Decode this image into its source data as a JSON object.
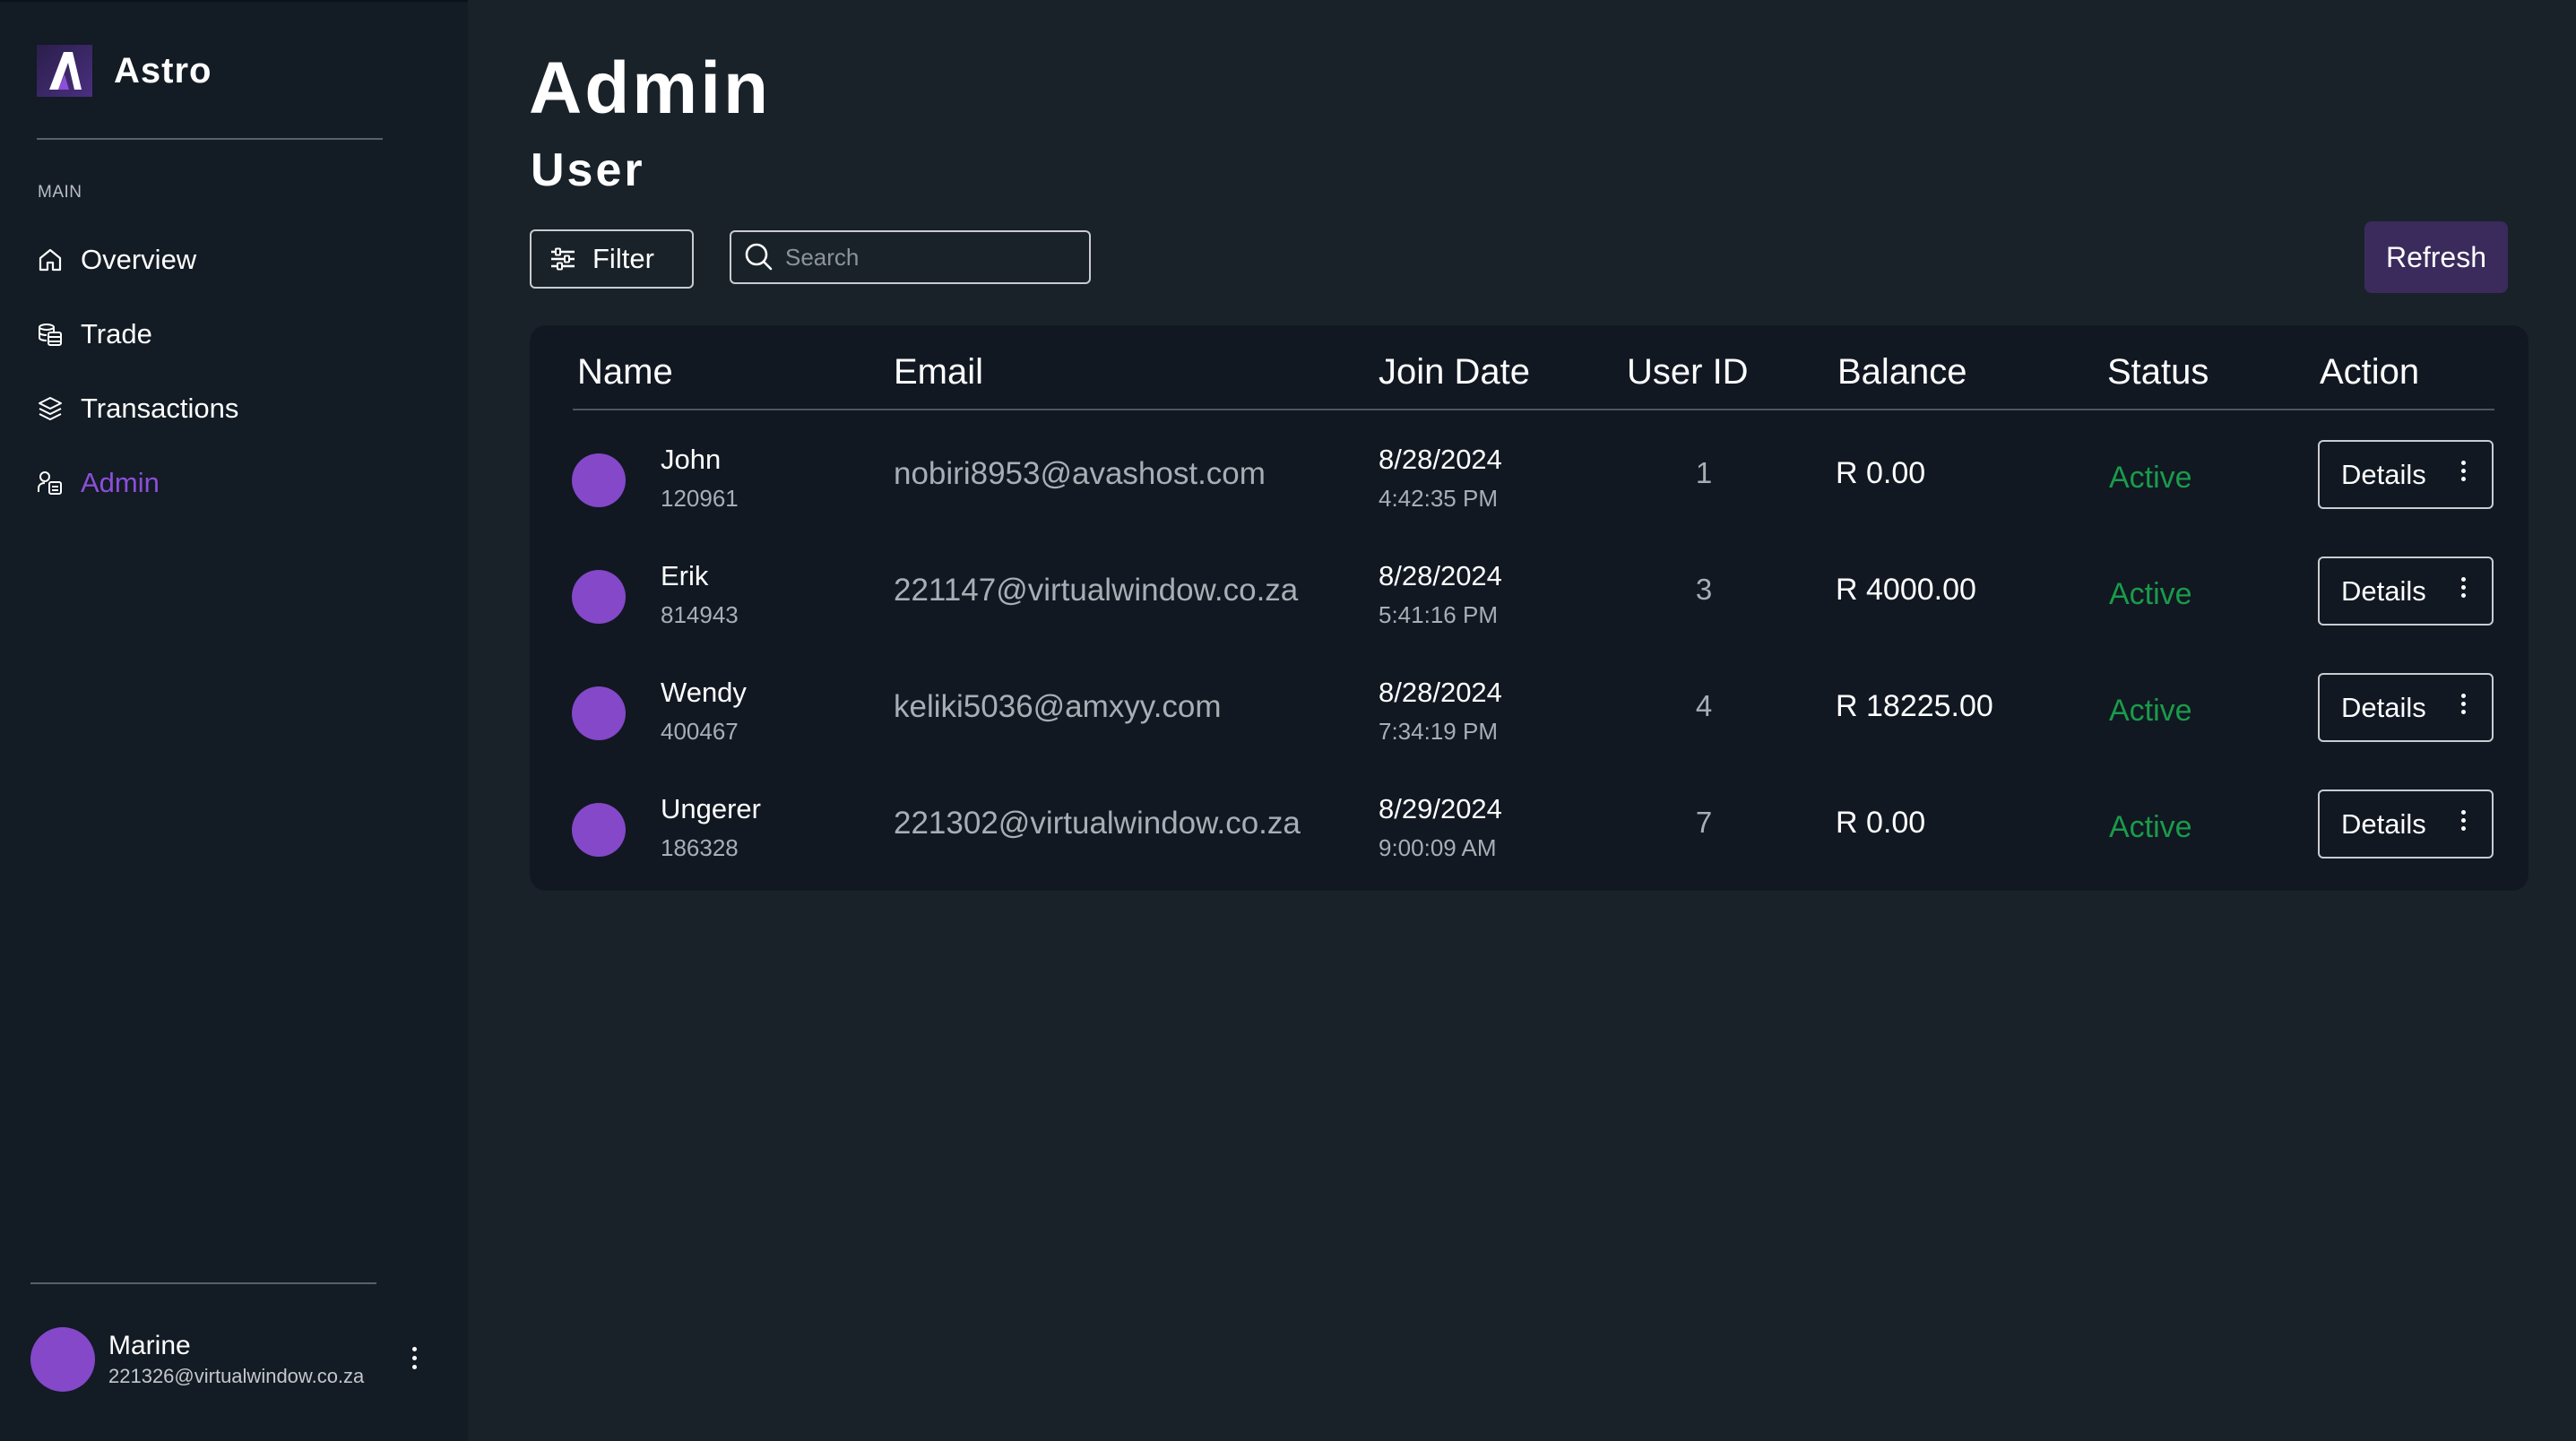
{
  "app": {
    "name": "Astro",
    "brand_color": "#8b4fd8"
  },
  "sidebar": {
    "section_label": "MAIN",
    "items": [
      {
        "label": "Overview",
        "icon": "home-icon",
        "active": false
      },
      {
        "label": "Trade",
        "icon": "coins-stack-icon",
        "active": false
      },
      {
        "label": "Transactions",
        "icon": "layers-icon",
        "active": false
      },
      {
        "label": "Admin",
        "icon": "admin-users-icon",
        "active": true
      }
    ],
    "profile": {
      "name": "Marine",
      "email": "221326@virtualwindow.co.za"
    }
  },
  "header": {
    "title": "Admin",
    "subtitle": "User"
  },
  "toolbar": {
    "filter_label": "Filter",
    "search_placeholder": "Search",
    "refresh_label": "Refresh"
  },
  "table": {
    "columns": [
      "Name",
      "Email",
      "Join Date",
      "User ID",
      "Balance",
      "Status",
      "Action"
    ],
    "rows": [
      {
        "name": "John",
        "code": "120961",
        "email": "nobiri8953@avashost.com",
        "date": "8/28/2024",
        "time": "4:42:35 PM",
        "user_id": "1",
        "balance": "R 0.00",
        "status": "Active",
        "action": "Details"
      },
      {
        "name": "Erik",
        "code": "814943",
        "email": "221147@virtualwindow.co.za",
        "date": "8/28/2024",
        "time": "5:41:16 PM",
        "user_id": "3",
        "balance": "R 4000.00",
        "status": "Active",
        "action": "Details"
      },
      {
        "name": "Wendy",
        "code": "400467",
        "email": "keliki5036@amxyy.com",
        "date": "8/28/2024",
        "time": "7:34:19 PM",
        "user_id": "4",
        "balance": "R 18225.00",
        "status": "Active",
        "action": "Details"
      },
      {
        "name": "Ungerer",
        "code": "186328",
        "email": "221302@virtualwindow.co.za",
        "date": "8/29/2024",
        "time": "9:00:09 AM",
        "user_id": "7",
        "balance": "R 0.00",
        "status": "Active",
        "action": "Details"
      }
    ]
  },
  "colors": {
    "background": "#1a2229",
    "sidebar": "#131b24",
    "card": "#111822",
    "avatar": "#8448c9",
    "status_active": "#1a9b4a",
    "refresh_button": "#3a2b5c"
  }
}
